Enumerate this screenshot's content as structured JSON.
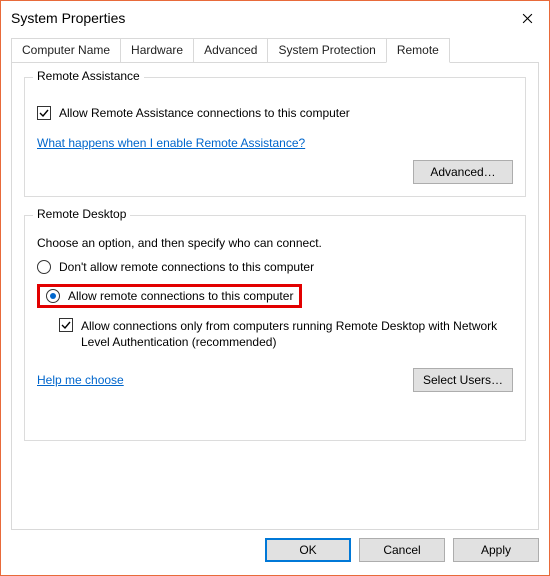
{
  "window": {
    "title": "System Properties"
  },
  "tabs": {
    "computer_name": "Computer Name",
    "hardware": "Hardware",
    "advanced": "Advanced",
    "system_protection": "System Protection",
    "remote": "Remote"
  },
  "remote_assistance": {
    "group_title": "Remote Assistance",
    "checkbox_label": "Allow Remote Assistance connections to this computer",
    "link_text": "What happens when I enable Remote Assistance?",
    "advanced_button": "Advanced…"
  },
  "remote_desktop": {
    "group_title": "Remote Desktop",
    "prompt": "Choose an option, and then specify who can connect.",
    "option_disallow": "Don't allow remote connections to this computer",
    "option_allow": "Allow remote connections to this computer",
    "nla_checkbox": "Allow connections only from computers running Remote Desktop with Network Level Authentication (recommended)",
    "help_link": "Help me choose",
    "select_users_button": "Select Users…"
  },
  "dialog_buttons": {
    "ok": "OK",
    "cancel": "Cancel",
    "apply": "Apply"
  }
}
